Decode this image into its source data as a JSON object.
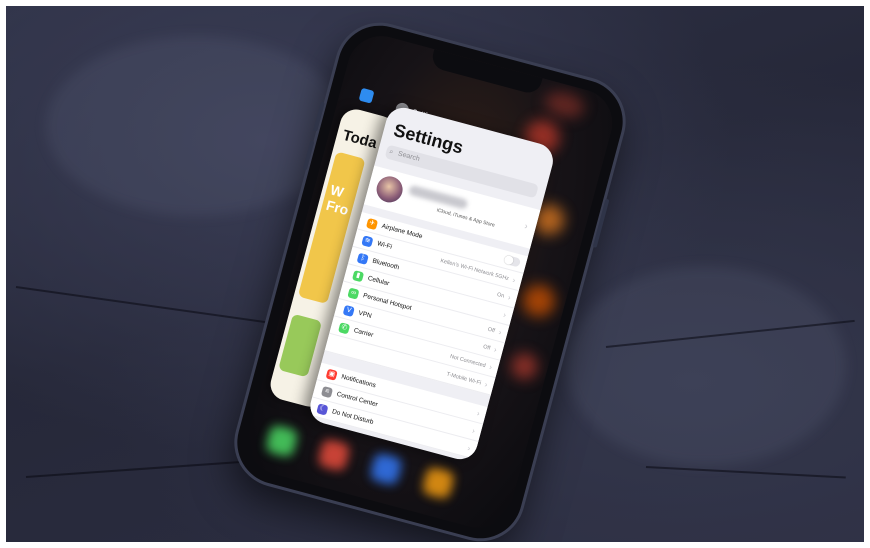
{
  "scene": {
    "description_colors": {
      "background_slate": "#2a2d40",
      "phone_frame": "#0c0c10",
      "accent_blue": "#3478f6"
    }
  },
  "switcher": {
    "app_labels": [
      {
        "label": "Settings",
        "icon": "settings-gear-icon"
      }
    ],
    "back_card": {
      "title": "Toda",
      "feature_text": "W\nFro"
    }
  },
  "settings": {
    "title": "Settings",
    "search_placeholder": "Search",
    "profile_subtitle": "iCloud, iTunes & App Store",
    "group1": [
      {
        "label": "Airplane Mode",
        "value": "",
        "control": "toggle",
        "icon_color": "#ff9500",
        "icon": "airplane-icon"
      },
      {
        "label": "Wi-Fi",
        "value": "Kellen's Wi-Fi Network 5GHz",
        "control": "chevron",
        "icon_color": "#3478f6",
        "icon": "wifi-icon"
      },
      {
        "label": "Bluetooth",
        "value": "On",
        "control": "chevron",
        "icon_color": "#3478f6",
        "icon": "bluetooth-icon"
      },
      {
        "label": "Cellular",
        "value": "",
        "control": "chevron",
        "icon_color": "#4cd964",
        "icon": "cellular-icon"
      },
      {
        "label": "Personal Hotspot",
        "value": "Off",
        "control": "chevron",
        "icon_color": "#4cd964",
        "icon": "hotspot-icon"
      },
      {
        "label": "VPN",
        "value": "Off",
        "control": "chevron",
        "icon_color": "#3478f6",
        "icon": "vpn-icon"
      },
      {
        "label": "Carrier",
        "value": "Not Connected",
        "control": "chevron",
        "icon_color": "#4cd964",
        "icon": "carrier-icon"
      },
      {
        "label": "",
        "value": "T-Mobile Wi-Fi",
        "control": "chevron",
        "icon_color": "",
        "icon": ""
      }
    ],
    "group2": [
      {
        "label": "Notifications",
        "value": "",
        "control": "chevron",
        "icon_color": "#ff3b30",
        "icon": "notifications-icon"
      },
      {
        "label": "Control Center",
        "value": "",
        "control": "chevron",
        "icon_color": "#8e8e93",
        "icon": "control-center-icon"
      },
      {
        "label": "Do Not Disturb",
        "value": "",
        "control": "chevron",
        "icon_color": "#5856d6",
        "icon": "moon-icon"
      }
    ]
  }
}
